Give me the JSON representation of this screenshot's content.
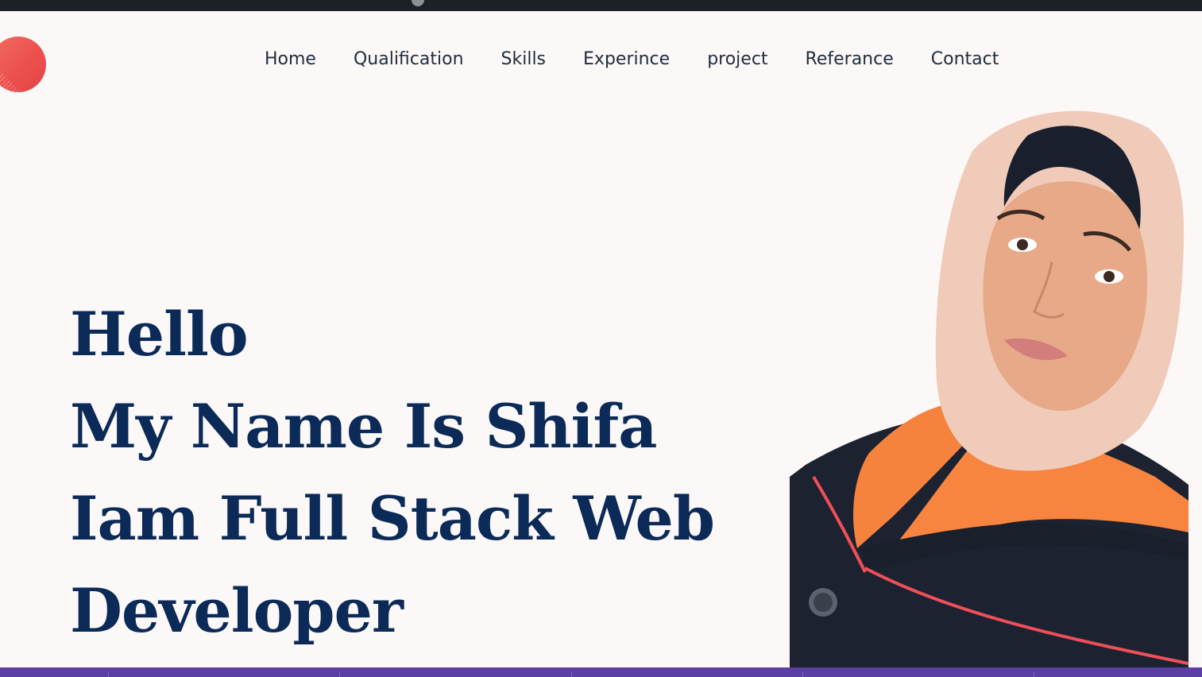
{
  "nav": {
    "items": [
      {
        "label": "Home"
      },
      {
        "label": "Qualification"
      },
      {
        "label": "Skills"
      },
      {
        "label": "Experince"
      },
      {
        "label": "project"
      },
      {
        "label": "Referance"
      },
      {
        "label": "Contact"
      }
    ]
  },
  "hero": {
    "line1": "Hello",
    "line2": "My Name Is Shifa",
    "line3": "Iam Full Stack Web",
    "line4": "Developer"
  },
  "colors": {
    "background": "#fcf8f8",
    "heading": "#0b2a57",
    "nav_text": "#1f2d3d",
    "logo": "#ec4f4c",
    "top_strip": "#1b2126",
    "bottom_bar": "#5b3fa4"
  },
  "icons": {
    "logo": "red-circle-logo-icon"
  }
}
